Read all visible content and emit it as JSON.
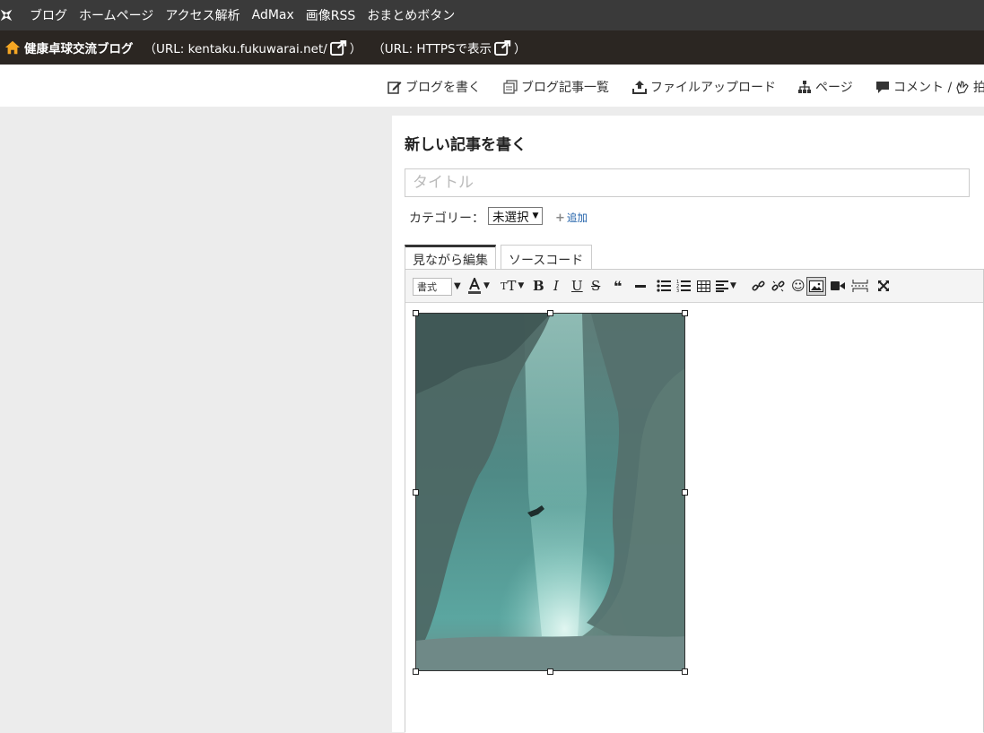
{
  "topnav": {
    "logo_icon": "fukuwarai-logo-icon",
    "items": [
      "ブログ",
      "ホームページ",
      "アクセス解析",
      "AdMax",
      "画像RSS",
      "おまとめボタン"
    ]
  },
  "blogbar": {
    "home_icon": "home-icon",
    "blog_name": "健康卓球交流ブログ",
    "url_text": "（URL: kentaku.fukuwarai.net/",
    "url_close": "）",
    "https_text": "（URL: HTTPSで表示",
    "https_close": "）"
  },
  "actions": [
    {
      "label": "ブログを書く",
      "icon": "edit-icon"
    },
    {
      "label": "ブログ記事一覧",
      "icon": "list-icon"
    },
    {
      "label": "ファイルアップロード",
      "icon": "upload-icon"
    },
    {
      "label": "ページ",
      "icon": "sitemap-icon"
    },
    {
      "label": "コメント /",
      "icon": "comment-icon"
    },
    {
      "label": "拍",
      "icon": "clap-icon"
    }
  ],
  "editor": {
    "panel_title": "新しい記事を書く",
    "title_placeholder": "タイトル",
    "title_value": "",
    "category_label": "カテゴリー：",
    "category_selected": "未選択",
    "add_label": "追加",
    "tabs": [
      "見ながら編集",
      "ソースコード"
    ],
    "active_tab": "見ながら編集",
    "format_select": "書式"
  },
  "toolbar_icons": [
    "format-select",
    "font-color-icon",
    "font-size-icon",
    "bold-icon",
    "italic-icon",
    "underline-icon",
    "strikethrough-icon",
    "blockquote-icon",
    "horizontal-rule-icon",
    "bullet-list-icon",
    "numbered-list-icon",
    "table-icon",
    "align-icon",
    "link-icon",
    "unlink-icon",
    "emoji-icon",
    "image-icon",
    "video-icon",
    "page-break-icon",
    "fullscreen-icon"
  ],
  "colors": {
    "topnav_bg": "#3a3a3a",
    "blogbar_bg": "#2b2622",
    "home_icon": "#f5a623",
    "link": "#1e5fa8"
  }
}
